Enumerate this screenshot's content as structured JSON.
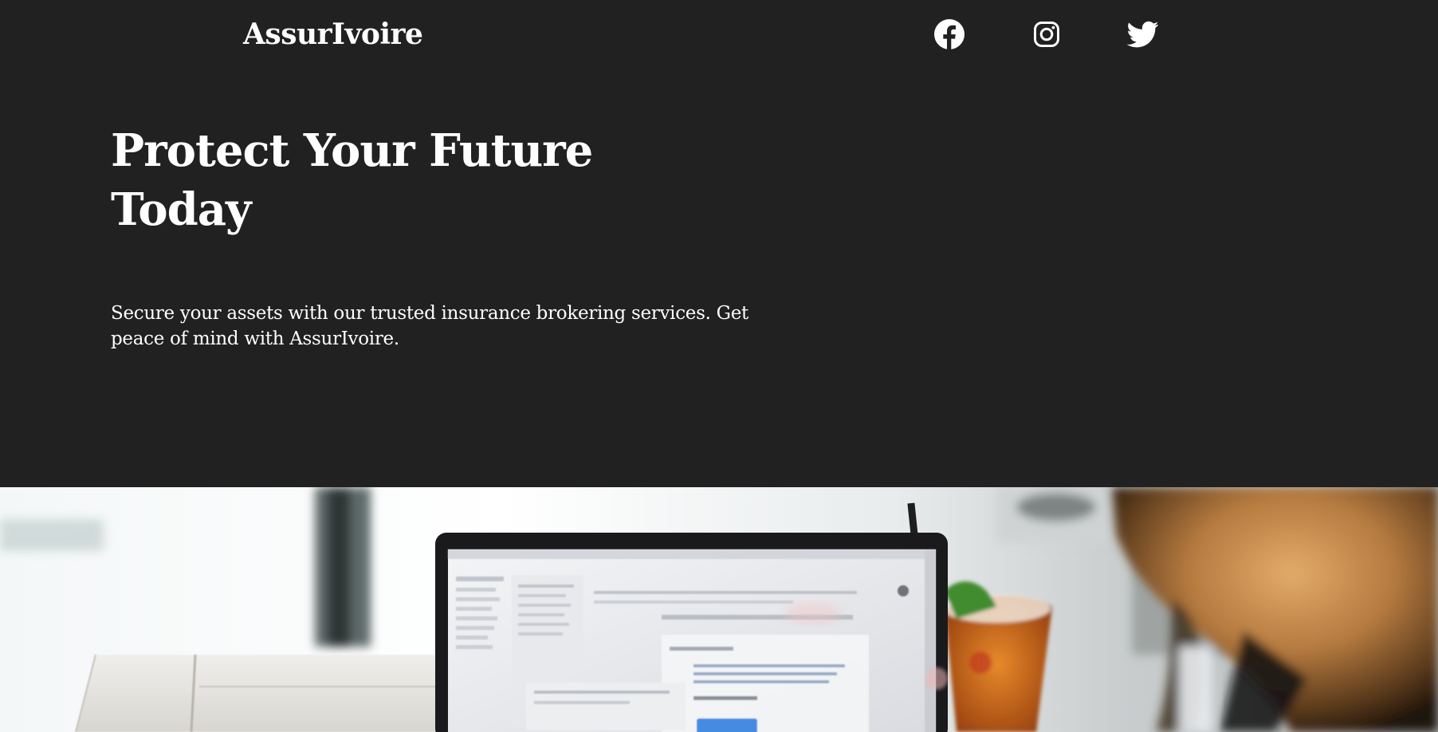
{
  "header": {
    "brand": "AssurIvoire",
    "social": [
      {
        "name": "facebook-icon"
      },
      {
        "name": "instagram-icon"
      },
      {
        "name": "twitter-icon"
      }
    ]
  },
  "hero": {
    "headline": "Protect Your Future Today",
    "subtext": "Secure your assets with our trusted insurance brokering services. Get peace of mind with AssurIvoire."
  },
  "colors": {
    "background": "#212121",
    "text": "#ffffff",
    "photo_accent": "#2a7de1"
  }
}
